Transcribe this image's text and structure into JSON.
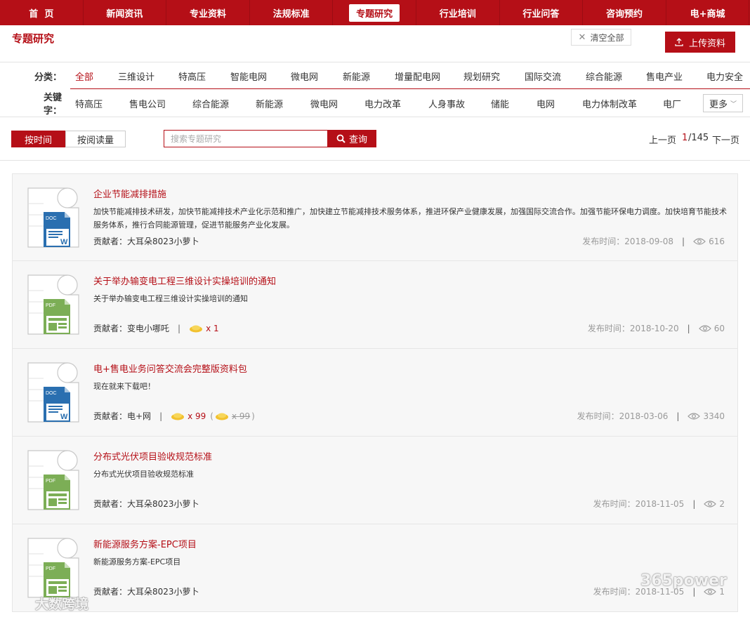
{
  "nav": {
    "items": [
      "首  页",
      "新闻资讯",
      "专业资料",
      "法规标准",
      "专题研究",
      "行业培训",
      "行业问答",
      "咨询预约",
      "电+商城"
    ],
    "active_index": 4
  },
  "header": {
    "page_title": "专题研究",
    "clear_label": "清空全部",
    "upload_label": "上传资料"
  },
  "filters": {
    "category_label": "分类：",
    "categories": [
      "全部",
      "三维设计",
      "特高压",
      "智能电网",
      "微电网",
      "新能源",
      "增量配电网",
      "规划研究",
      "国际交流",
      "综合能源",
      "售电产业",
      "电力安全"
    ],
    "category_active": 0,
    "keyword_label": "关键字：",
    "keywords": [
      "特高压",
      "售电公司",
      "综合能源",
      "新能源",
      "微电网",
      "电力改革",
      "人身事故",
      "储能",
      "电网",
      "电力体制改革",
      "电厂"
    ],
    "more_label": "更多"
  },
  "toolbar": {
    "sort_time": "按时间",
    "sort_read": "按阅读量",
    "search_placeholder": "搜索专题研究",
    "search_label": "查询",
    "prev_label": "上一页",
    "page_current": "1",
    "page_total": "/145",
    "next_label": "下一页"
  },
  "items": [
    {
      "type": "DOC",
      "title": "企业节能减排措施",
      "desc": "加快节能减排技术研发，加快节能减排技术产业化示范和推广，加快建立节能减排技术服务体系，推进环保产业健康发展，加强国际交流合作。加强节能环保电力调度。加快培育节能技术服务体系，推行合同能源管理，促进节能服务产业化发展。",
      "contributor": "贡献者：大耳朵8023小萝卜",
      "price": "",
      "orig_price": "",
      "date": "发布时间：2018-09-08",
      "views": "616"
    },
    {
      "type": "PDF",
      "title": "关于举办输变电工程三维设计实操培训的通知",
      "desc": "关于举办输变电工程三维设计实操培训的通知",
      "contributor": "贡献者：变电小哪吒",
      "price": "x 1",
      "orig_price": "",
      "date": "发布时间：2018-10-20",
      "views": "60"
    },
    {
      "type": "DOC",
      "title": "电+售电业务问答交流会完整版资料包",
      "desc": "现在就来下载吧！",
      "contributor": "贡献者：电+网",
      "price": "x 99",
      "orig_price": "x 99",
      "date": "发布时间：2018-03-06",
      "views": "3340"
    },
    {
      "type": "PDF",
      "title": "分布式光伏项目验收规范标准",
      "desc": "分布式光伏项目验收规范标准",
      "contributor": "贡献者：大耳朵8023小萝卜",
      "price": "",
      "orig_price": "",
      "date": "发布时间：2018-11-05",
      "views": "2"
    },
    {
      "type": "PDF",
      "title": "新能源服务方案-EPC项目",
      "desc": "新能源服务方案-EPC项目",
      "contributor": "贡献者：大耳朵8023小萝卜",
      "price": "",
      "orig_price": "",
      "date": "发布时间：2018-11-05",
      "views": "1"
    }
  ],
  "watermarks": {
    "left": "大数跨境",
    "right": "365power"
  },
  "colors": {
    "brand": "#b50f17",
    "doc_blue": "#2a6fb0",
    "pdf_green": "#7cae56"
  }
}
